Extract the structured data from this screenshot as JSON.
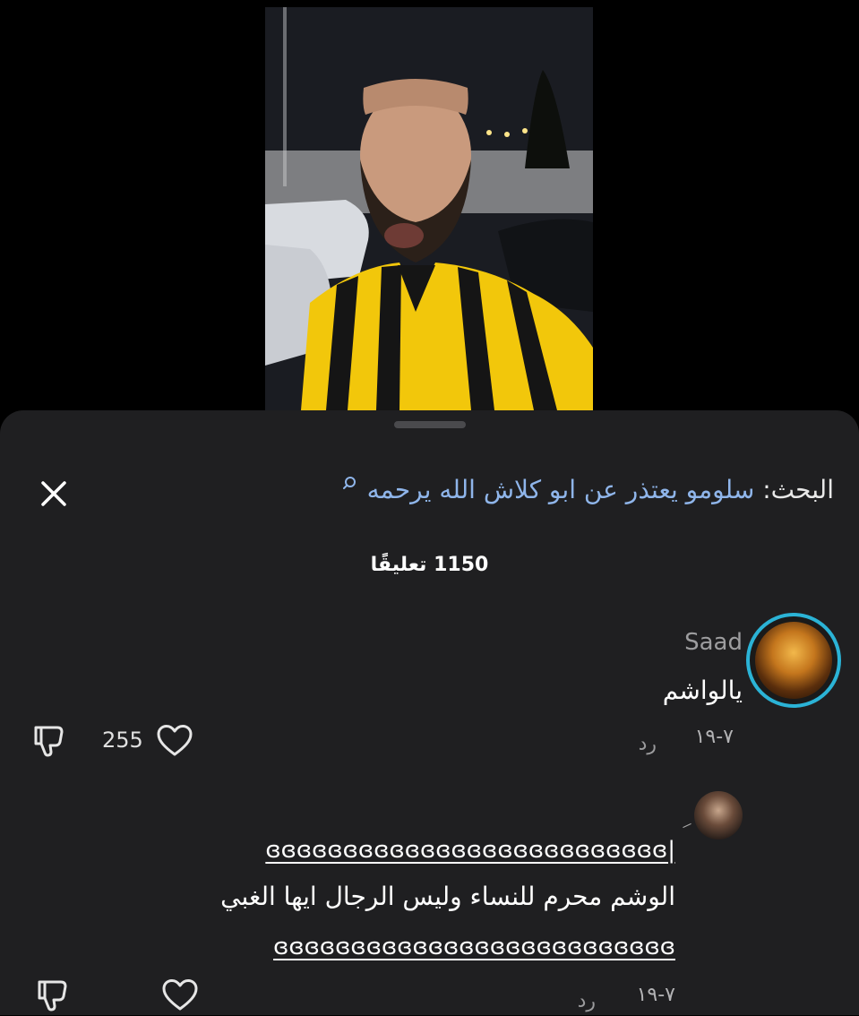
{
  "search": {
    "label": "البحث:",
    "query": "سلومو يعتذر عن ابو كلاش الله يرحمه"
  },
  "comments_count": "1150 تعليقًا",
  "comments": [
    {
      "username": "Saad",
      "text": "يالواشم",
      "date": "٧-١٩",
      "reply": "رد",
      "likes": "255"
    },
    {
      "text_lines": [
        "ɞɞɞɞɞɞɞɞɞɞɞɞɞɞɞɞɞɞɞɞɞɞɞɞɞɞ|",
        "الوشم محرم للنساء وليس الرجال ايها الغبي",
        "ɞɞɞɞɞɞɞɞɞɞɞɞɞɞɞɞɞɞɞɞɞɞɞɞɞɞ"
      ],
      "date": "٧-١٩",
      "reply": "رد"
    }
  ],
  "colors": {
    "sheet_bg": "#1f1f21",
    "query_link": "#8fb5ea",
    "avatar_ring": "#2bb3d6",
    "shirt_yellow": "#f2c70b"
  },
  "icons": [
    "search-icon",
    "close-icon",
    "heart-icon",
    "dislike-icon"
  ]
}
